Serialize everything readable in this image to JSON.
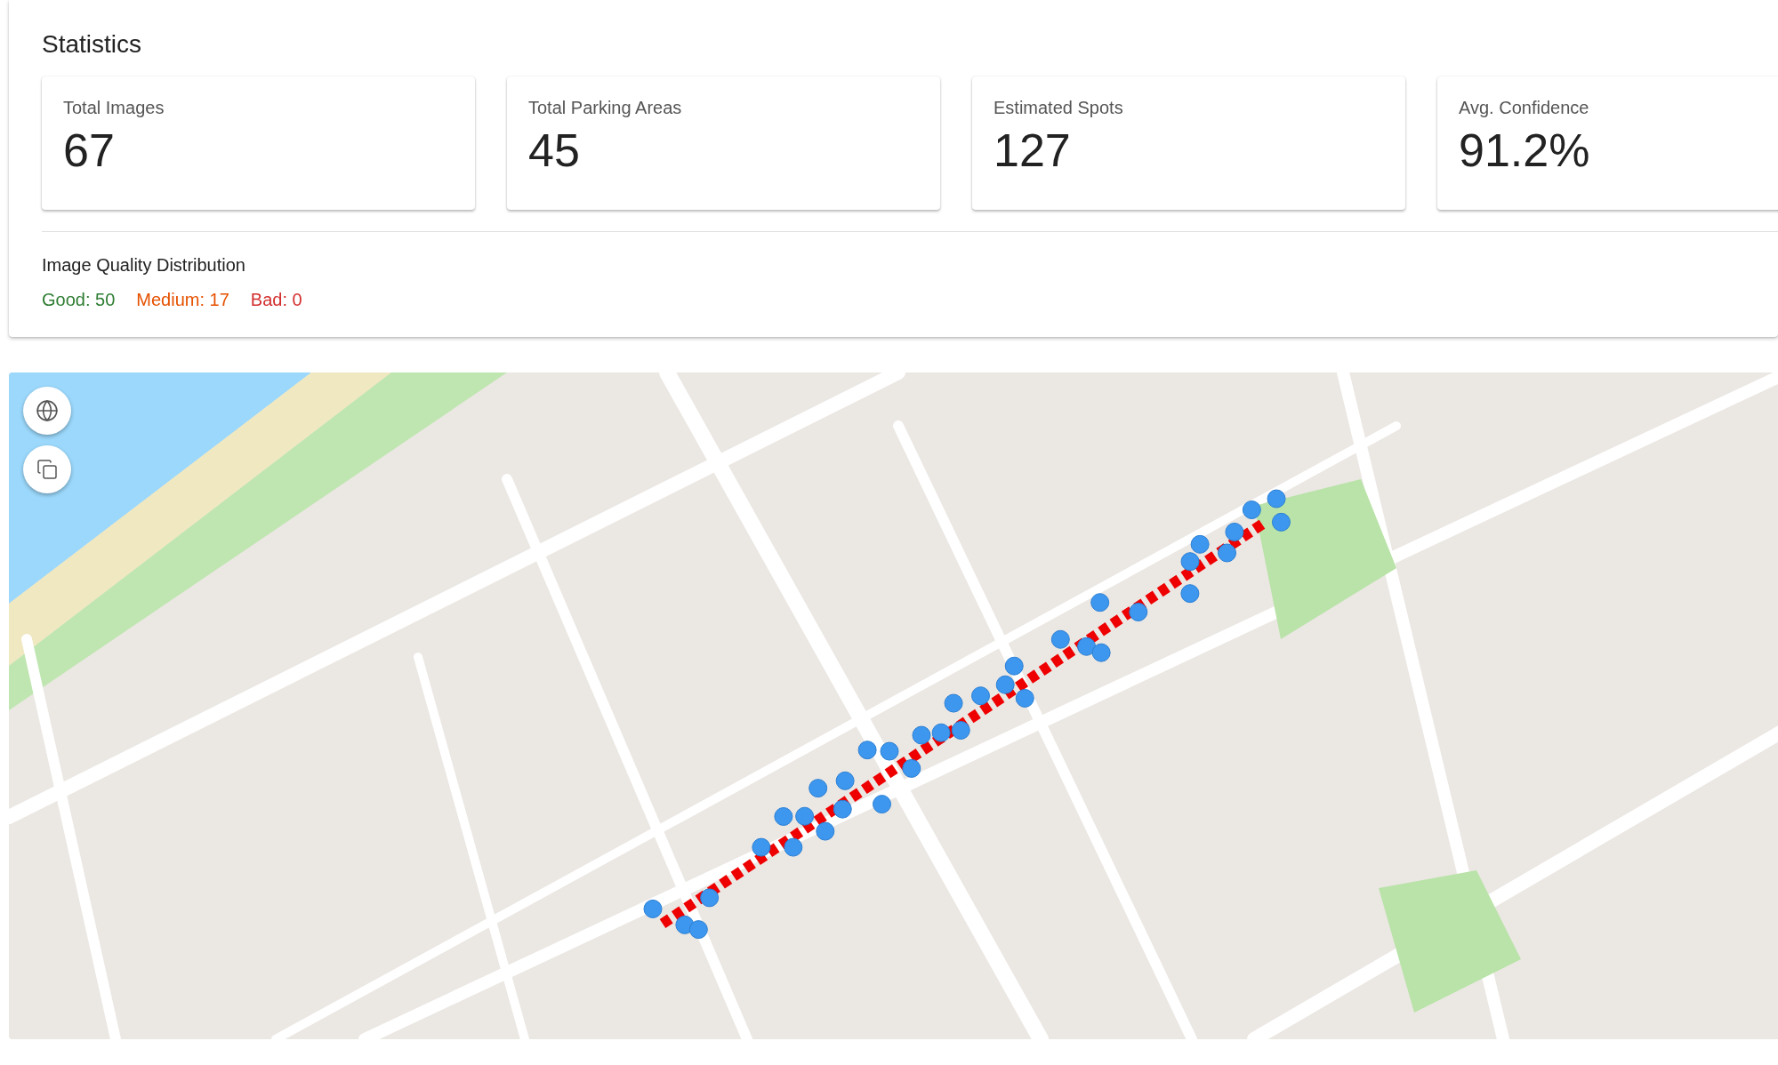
{
  "statistics": {
    "title": "Statistics",
    "cards": [
      {
        "label": "Total Images",
        "value": "67"
      },
      {
        "label": "Total Parking Areas",
        "value": "45"
      },
      {
        "label": "Estimated Spots",
        "value": "127"
      },
      {
        "label": "Avg. Confidence",
        "value": "91.2%"
      }
    ],
    "quality": {
      "title": "Image Quality Distribution",
      "items": [
        {
          "text": "Good: 50",
          "color": "#2e7d32"
        },
        {
          "text": "Medium: 17",
          "color": "#e65100"
        },
        {
          "text": "Bad: 0",
          "color": "#d32f2f"
        }
      ]
    }
  }
}
